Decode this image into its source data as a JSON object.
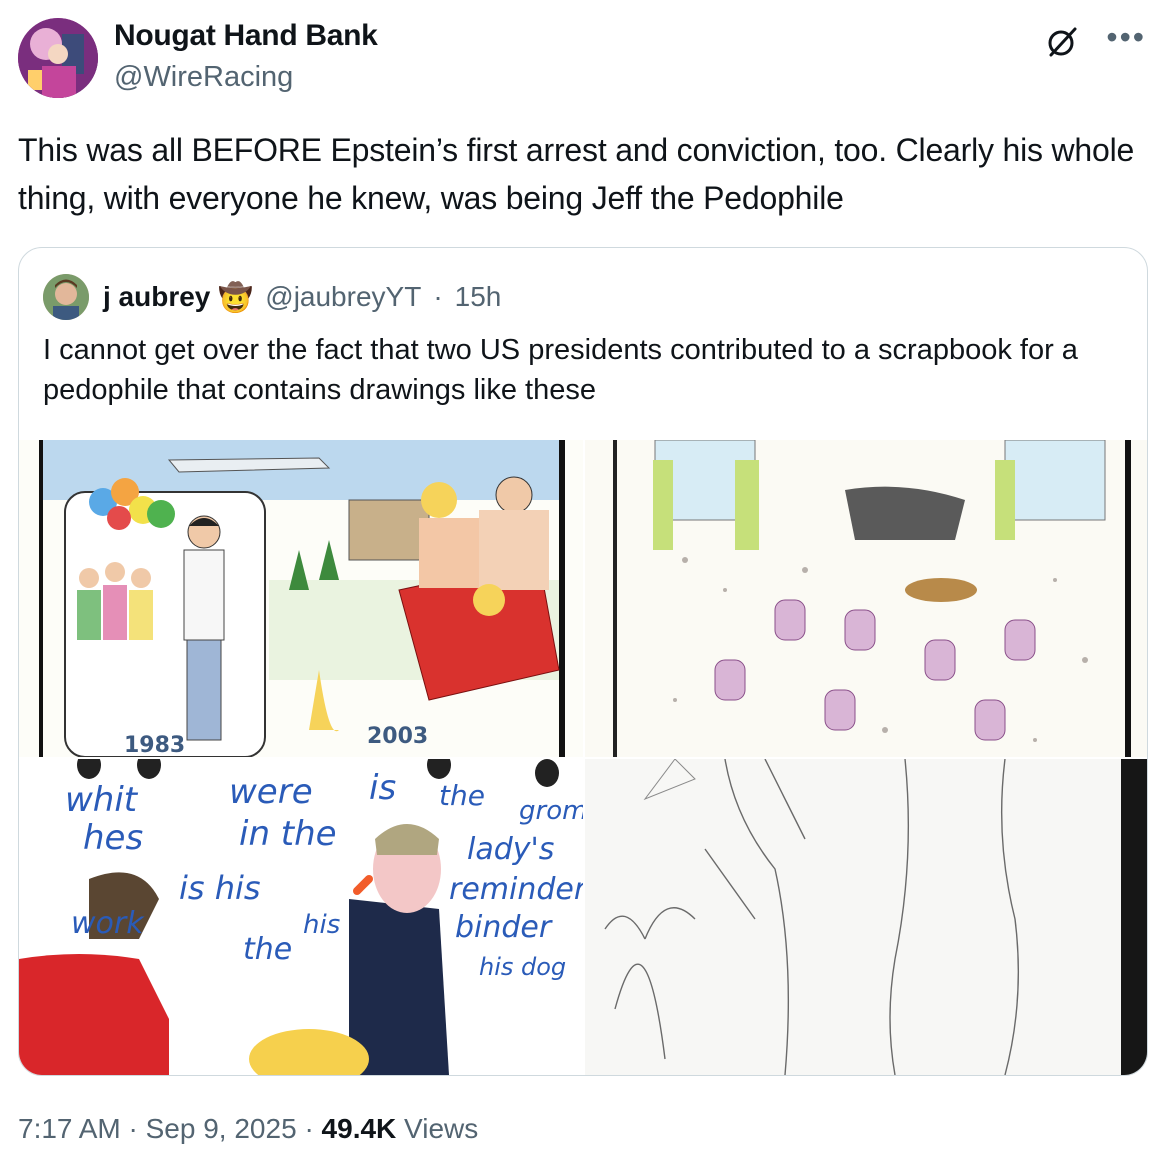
{
  "author": {
    "name": "Nougat Hand Bank",
    "handle": "@WireRacing"
  },
  "tweet": {
    "text": "This was all BEFORE Epstein’s first arrest and conviction, too. Clearly his whole thing, with everyone he knew, was being Jeff the Pedophile"
  },
  "icons": {
    "grok": "grok-icon",
    "more": "more-icon",
    "cowboy": "🤠"
  },
  "quote": {
    "name": "j aubrey",
    "handle": "@jaubreyYT",
    "separator": "·",
    "time": "15h",
    "text": "I cannot get over the fact that two US presidents contributed to a scrapbook for a pedophile that contains drawings like these"
  },
  "images": {
    "image1": {
      "label_left": "1983",
      "label_right": "2003"
    },
    "image3": {
      "words": [
        "whit",
        "hes",
        "were",
        "in the",
        "is",
        "the",
        "grom",
        "lady's",
        "reminder",
        "binder",
        "his",
        "his dog",
        "work",
        "the",
        "is his"
      ]
    }
  },
  "footer": {
    "time": "7:17 AM",
    "dot1": "·",
    "date": "Sep 9, 2025",
    "dot2": "·",
    "views": "49.4K",
    "views_label": "Views"
  },
  "colors": {
    "text": "#0f1419",
    "secondary": "#536471",
    "border": "#cfd9de"
  }
}
